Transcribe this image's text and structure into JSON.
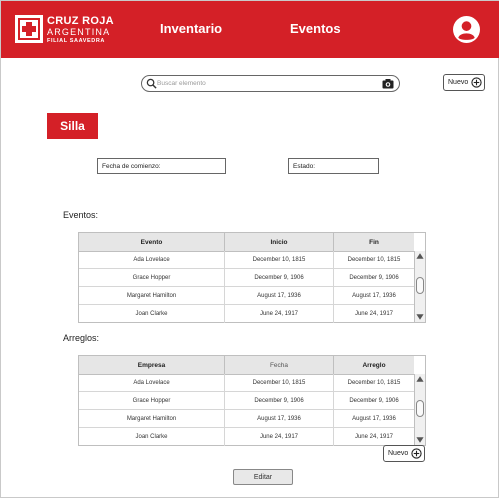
{
  "header": {
    "logo": {
      "line1": "CRUZ ROJA",
      "line2": "ARGENTINA",
      "line3": "FILIAL SAAVEDRA"
    },
    "nav": [
      {
        "label": "Inventario"
      },
      {
        "label": "Eventos"
      }
    ]
  },
  "search": {
    "placeholder": "Buscar elemento"
  },
  "top_new_button": {
    "label": "Nuevo"
  },
  "item": {
    "title": "Silla"
  },
  "fields": {
    "start_date": {
      "label": "Fecha de comienzo:"
    },
    "status": {
      "label": "Estado:"
    }
  },
  "events": {
    "label": "Eventos:",
    "columns": [
      "Evento",
      "Inicio",
      "Fin"
    ],
    "rows": [
      [
        "Ada Lovelace",
        "December 10, 1815",
        "December 10, 1815"
      ],
      [
        "Grace Hopper",
        "December 9, 1906",
        "December 9, 1906"
      ],
      [
        "Margaret Hamilton",
        "August 17, 1936",
        "August 17, 1936"
      ],
      [
        "Joan Clarke",
        "June 24, 1917",
        "June 24, 1917"
      ]
    ]
  },
  "repairs": {
    "label": "Arreglos:",
    "columns": [
      "Empresa",
      "Fecha",
      "Arreglo"
    ],
    "rows": [
      [
        "Ada Lovelace",
        "December 10, 1815",
        "December 10, 1815"
      ],
      [
        "Grace Hopper",
        "December 9, 1906",
        "December 9, 1906"
      ],
      [
        "Margaret Hamilton",
        "August 17, 1936",
        "August 17, 1936"
      ],
      [
        "Joan Clarke",
        "June 24, 1917",
        "June 24, 1917"
      ]
    ],
    "new_button": {
      "label": "Nuevo"
    }
  },
  "edit_button": {
    "label": "Editar"
  },
  "colors": {
    "brand_red": "#d42027"
  }
}
